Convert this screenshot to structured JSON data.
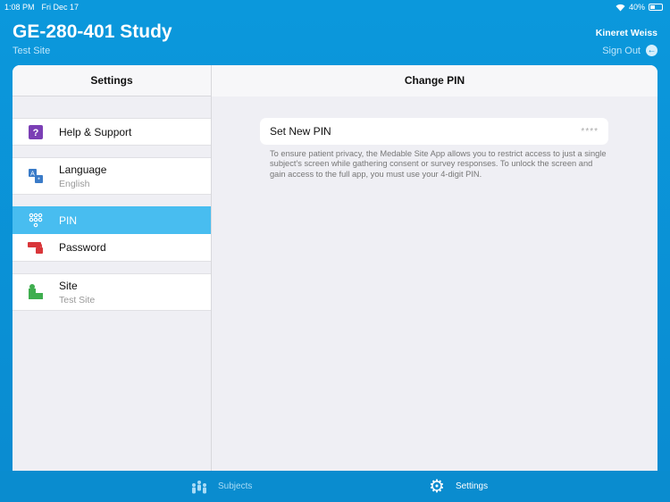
{
  "status": {
    "time": "1:08 PM",
    "date": "Fri Dec 17",
    "battery": "40%",
    "battery_level": 0.4
  },
  "header": {
    "title": "GE-280-401 Study",
    "subtitle": "Test Site",
    "user": "Kineret Weiss",
    "sign_out": "Sign Out"
  },
  "sidebar": {
    "title": "Settings",
    "items": [
      {
        "label": "Help & Support",
        "icon": "help-icon"
      },
      {
        "label": "Language",
        "detail": "English",
        "icon": "language-icon"
      },
      {
        "label": "PIN",
        "icon": "keypad-icon",
        "selected": true
      },
      {
        "label": "Password",
        "icon": "password-lock-icon"
      },
      {
        "label": "Site",
        "detail": "Test Site",
        "icon": "site-icon"
      }
    ]
  },
  "detail": {
    "title": "Change PIN",
    "field_label": "Set New PIN",
    "field_value": "****",
    "description": "To ensure patient privacy, the Medable Site App allows you to restrict access to just a single subject's screen while gathering consent or survey responses. To unlock the screen and gain access to the full app, you must use your 4-digit PIN."
  },
  "tabs": [
    {
      "label": "Subjects"
    },
    {
      "label": "Settings",
      "active": true
    }
  ],
  "colors": {
    "accent": "#0b98dc",
    "selected": "#48bdf0"
  }
}
